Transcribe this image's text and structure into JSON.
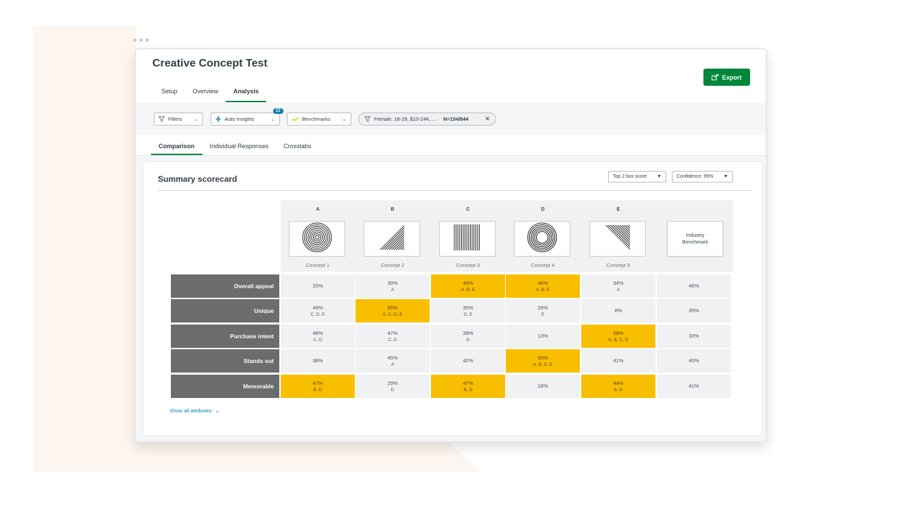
{
  "app": {
    "title": "Creative Concept Test",
    "export_label": "Export",
    "main_tabs": [
      {
        "label": "Setup",
        "active": false
      },
      {
        "label": "Overview",
        "active": false
      },
      {
        "label": "Analysis",
        "active": true
      }
    ]
  },
  "filters": {
    "filters_label": "Filters",
    "auto_insights_label": "Auto Insights",
    "auto_insights_badge": "21",
    "benchmarks_label": "Benchmarks",
    "chip_text": "Female, 18-29, $10-24K, ... ·",
    "chip_n": "N=154/844"
  },
  "sub_tabs": [
    {
      "label": "Comparison",
      "active": true
    },
    {
      "label": "Individual Responses",
      "active": false
    },
    {
      "label": "Crosstabs",
      "active": false
    }
  ],
  "scorecard": {
    "title": "Summary scorecard",
    "score_type": "Top 2 box score",
    "confidence": "Confidence: 95%",
    "benchmark_label_1": "Industry",
    "benchmark_label_2": "Benchmark",
    "columns": [
      {
        "letter": "A",
        "concept": "Concept 1",
        "icon": "concentric-circles-icon"
      },
      {
        "letter": "B",
        "concept": "Concept 2",
        "icon": "triangle-lines-icon"
      },
      {
        "letter": "C",
        "concept": "Concept 3",
        "icon": "vertical-lines-icon"
      },
      {
        "letter": "D",
        "concept": "Concept 4",
        "icon": "ring-circles-icon"
      },
      {
        "letter": "E",
        "concept": "Concept 5",
        "icon": "diagonal-lines-icon"
      }
    ],
    "rows": [
      {
        "label": "Overall appeal",
        "cells": [
          {
            "value": "25%",
            "sig": "",
            "hl": false
          },
          {
            "value": "39%",
            "sig": "A",
            "hl": false
          },
          {
            "value": "49%",
            "sig": "A, B, E",
            "hl": true
          },
          {
            "value": "46%",
            "sig": "A, B, E",
            "hl": true
          },
          {
            "value": "34%",
            "sig": "A",
            "hl": false
          }
        ],
        "benchmark": "46%"
      },
      {
        "label": "Unique",
        "cells": [
          {
            "value": "49%",
            "sig": "C, D, E",
            "hl": false
          },
          {
            "value": "55%",
            "sig": "A, C, D, E",
            "hl": true
          },
          {
            "value": "35%",
            "sig": "D, E",
            "hl": false
          },
          {
            "value": "26%",
            "sig": "E",
            "hl": false
          },
          {
            "value": "8%",
            "sig": "",
            "hl": false
          }
        ],
        "benchmark": "35%"
      },
      {
        "label": "Purchase intent",
        "cells": [
          {
            "value": "48%",
            "sig": "C, D",
            "hl": false
          },
          {
            "value": "47%",
            "sig": "C, D",
            "hl": false
          },
          {
            "value": "39%",
            "sig": "D",
            "hl": false
          },
          {
            "value": "13%",
            "sig": "",
            "hl": false
          },
          {
            "value": "58%",
            "sig": "A, B, C, D",
            "hl": true
          }
        ],
        "benchmark": "33%"
      },
      {
        "label": "Stands out",
        "cells": [
          {
            "value": "38%",
            "sig": "",
            "hl": false
          },
          {
            "value": "45%",
            "sig": "A",
            "hl": false
          },
          {
            "value": "42%",
            "sig": "",
            "hl": false
          },
          {
            "value": "90%",
            "sig": "A, B, C, E",
            "hl": true
          },
          {
            "value": "41%",
            "sig": "",
            "hl": false
          }
        ],
        "benchmark": "40%"
      },
      {
        "label": "Memorable",
        "cells": [
          {
            "value": "47%",
            "sig": "B, D",
            "hl": true
          },
          {
            "value": "29%",
            "sig": "D",
            "hl": false
          },
          {
            "value": "47%",
            "sig": "B, D",
            "hl": true
          },
          {
            "value": "18%",
            "sig": "",
            "hl": false
          },
          {
            "value": "44%",
            "sig": "B, D",
            "hl": true
          }
        ],
        "benchmark": "41%"
      }
    ],
    "show_all_label": "Show all attributes"
  },
  "colors": {
    "accent_green": "#00873c",
    "highlight_yellow": "#f8bf00",
    "row_label_gray": "#6b6c6e",
    "link_blue": "#007faa"
  }
}
